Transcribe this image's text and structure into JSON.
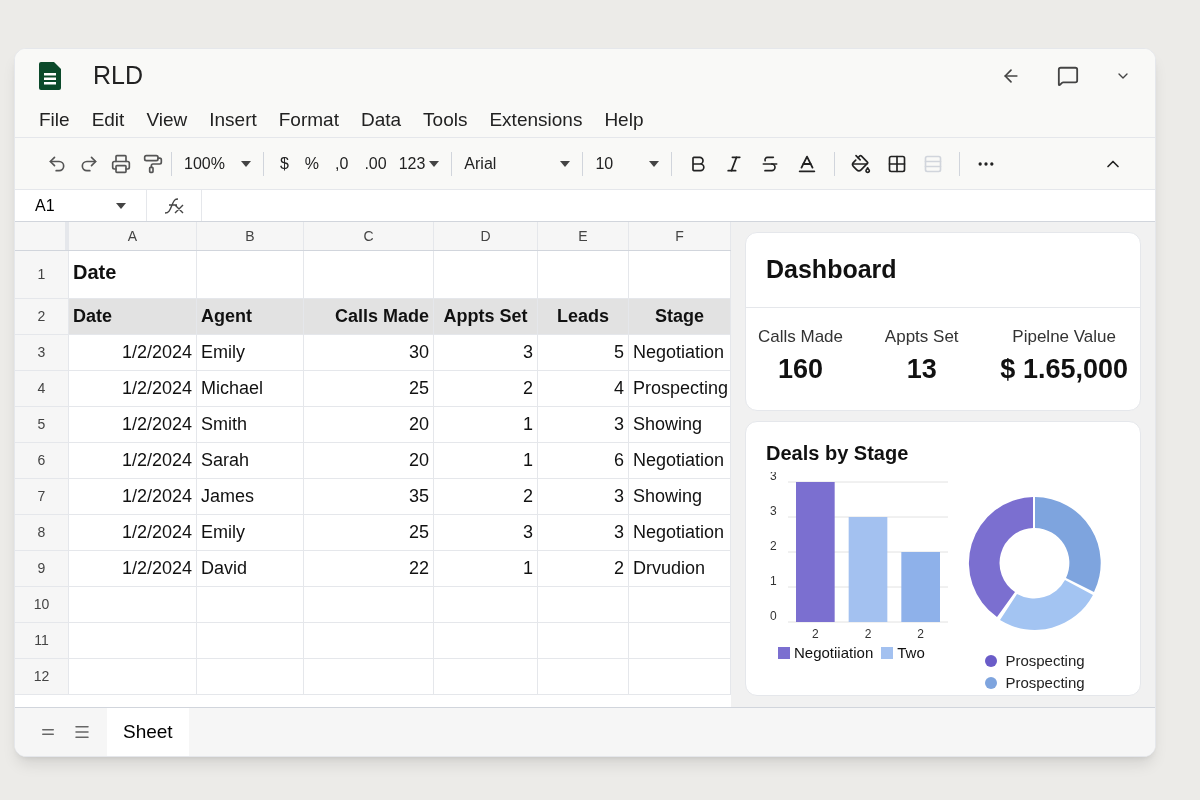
{
  "window": {
    "title": "RLD"
  },
  "menu": [
    "File",
    "Edit",
    "View",
    "Insert",
    "Format",
    "Data",
    "Tools",
    "Extensions",
    "Help"
  ],
  "toolbar": {
    "zoom": "100%",
    "currency": "$",
    "percent": "%",
    "decrease_decimals": ",0",
    "increase_decimals": ".00",
    "more_formats": "123",
    "font": "Arial",
    "font_size": "10"
  },
  "formula_bar": {
    "name_box": "A1"
  },
  "sheet": {
    "columns": [
      "A",
      "B",
      "C",
      "D",
      "E",
      "F"
    ],
    "rows": [
      {
        "number": "1",
        "kind": "title",
        "cells": [
          "Date",
          "",
          "",
          "",
          "",
          ""
        ]
      },
      {
        "number": "2",
        "kind": "header",
        "cells": [
          "Date",
          "Agent",
          "Calls Made",
          "Appts Set",
          "Leads",
          "Stage"
        ]
      },
      {
        "number": "3",
        "kind": "data",
        "cells": [
          "1/2/2024",
          "Emily",
          "30",
          "3",
          "5",
          "Negotiation"
        ]
      },
      {
        "number": "4",
        "kind": "data",
        "cells": [
          "1/2/2024",
          "Michael",
          "25",
          "2",
          "4",
          "Prospecting"
        ]
      },
      {
        "number": "5",
        "kind": "data",
        "cells": [
          "1/2/2024",
          "Smith",
          "20",
          "1",
          "3",
          "Showing"
        ]
      },
      {
        "number": "6",
        "kind": "data",
        "cells": [
          "1/2/2024",
          "Sarah",
          "20",
          "1",
          "6",
          "Negotiation"
        ]
      },
      {
        "number": "7",
        "kind": "data",
        "cells": [
          "1/2/2024",
          "James",
          "35",
          "2",
          "3",
          "Showing"
        ]
      },
      {
        "number": "8",
        "kind": "data",
        "cells": [
          "1/2/2024",
          "Emily",
          "25",
          "3",
          "3",
          "Negotiation"
        ]
      },
      {
        "number": "9",
        "kind": "data",
        "cells": [
          "1/2/2024",
          "David",
          "22",
          "1",
          "2",
          "Drvudion"
        ]
      },
      {
        "number": "10",
        "kind": "data",
        "cells": [
          "",
          "",
          "",
          "",
          "",
          ""
        ]
      },
      {
        "number": "11",
        "kind": "data",
        "cells": [
          "",
          "",
          "",
          "",
          "",
          ""
        ]
      },
      {
        "number": "12",
        "kind": "data",
        "cells": [
          "",
          "",
          "",
          "",
          "",
          ""
        ]
      }
    ]
  },
  "dashboard": {
    "title": "Dashboard",
    "stats": [
      {
        "label": "Calls Made",
        "value": "160"
      },
      {
        "label": "Appts Set",
        "value": "13"
      },
      {
        "label": "Pipelne Value",
        "value": "$ 1.65,000"
      }
    ]
  },
  "deals_card": {
    "title": "Deals by Stage",
    "bar_chart": {
      "y_axis_labels": [
        "3",
        "3",
        "2",
        "1",
        "0"
      ],
      "x_axis_labels": [
        "2",
        "2",
        "2"
      ],
      "legend": [
        {
          "label": "Negotiiation",
          "color": "#7b6fd0"
        },
        {
          "label": "Two",
          "color": "#a3c1f0"
        }
      ]
    },
    "donut_legend": [
      {
        "label": "Prospecting",
        "color": "#6a5cc8"
      },
      {
        "label": "Prospecting",
        "color": "#7ea4de"
      }
    ]
  },
  "sheet_tabs": [
    {
      "label": "Sheet",
      "selected": true
    }
  ]
}
